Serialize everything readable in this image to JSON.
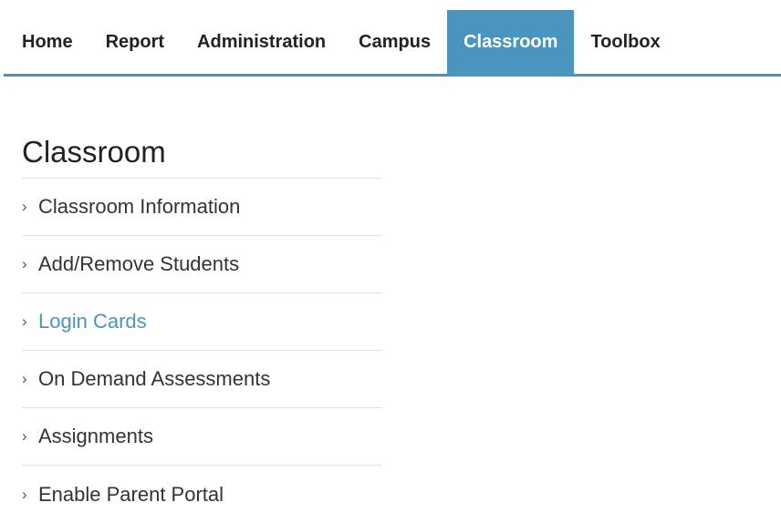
{
  "nav": {
    "items": [
      {
        "label": "Home"
      },
      {
        "label": "Report"
      },
      {
        "label": "Administration"
      },
      {
        "label": "Campus"
      },
      {
        "label": "Classroom"
      },
      {
        "label": "Toolbox"
      }
    ],
    "active_index": 4,
    "accent_color": "#4a95c0"
  },
  "sidebar": {
    "title": "Classroom",
    "chevron": "›",
    "items": [
      {
        "label": "Classroom Information"
      },
      {
        "label": "Add/Remove Students"
      },
      {
        "label": "Login Cards"
      },
      {
        "label": "On Demand Assessments"
      },
      {
        "label": "Assignments"
      },
      {
        "label": "Enable Parent Portal"
      }
    ],
    "active_index": 2
  }
}
